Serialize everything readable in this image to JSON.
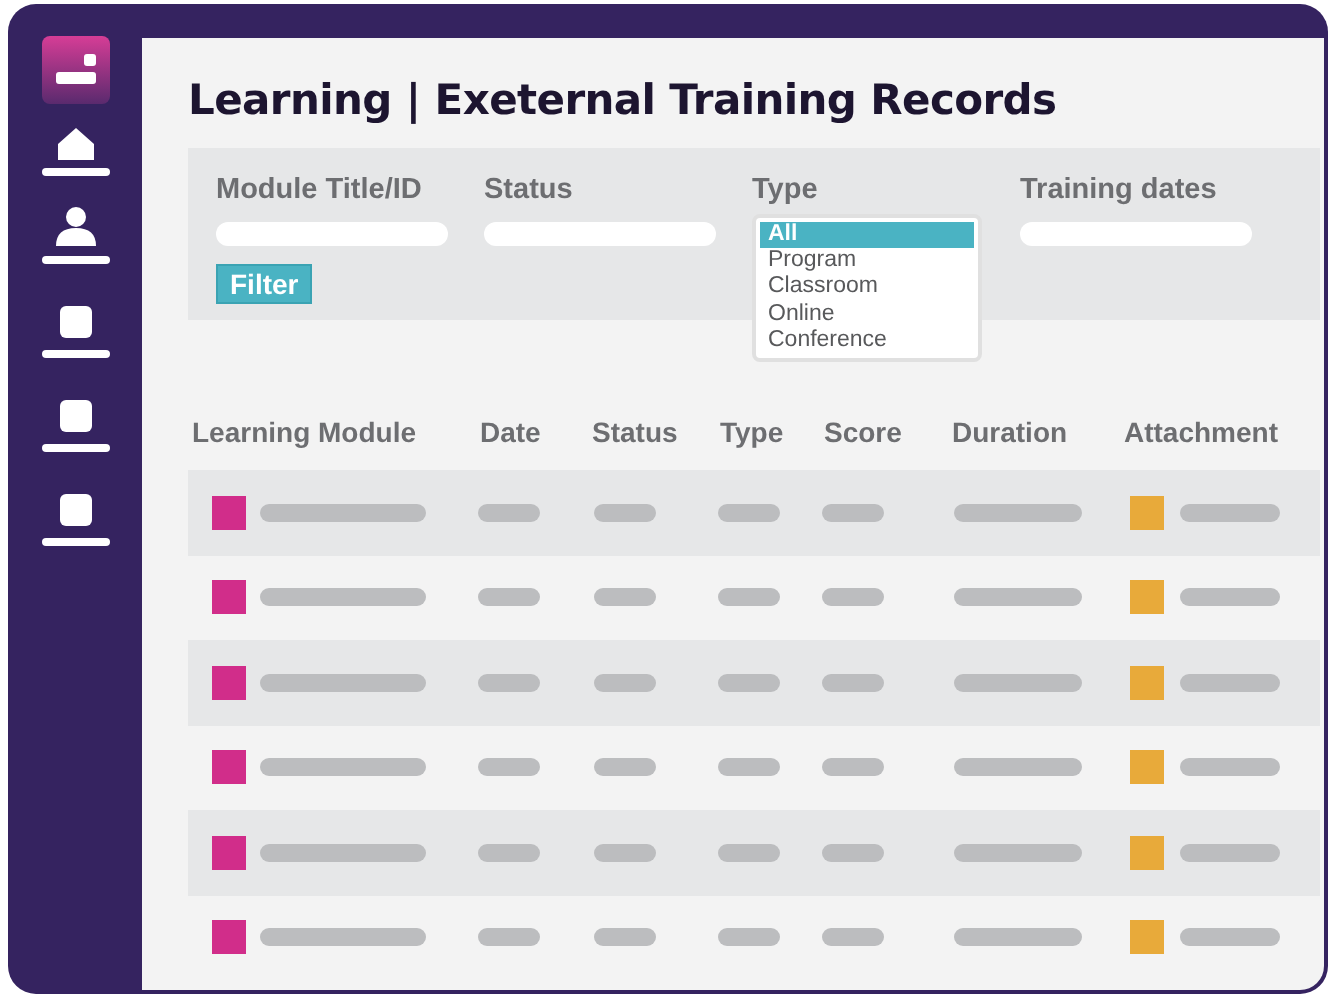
{
  "title": "Learning | Exeternal Training Records",
  "filters": [
    {
      "label": "Module Title/ID",
      "kind": "text"
    },
    {
      "label": "Status",
      "kind": "text"
    },
    {
      "label": "Type",
      "kind": "list",
      "options": [
        {
          "label": "All",
          "selected": true
        },
        {
          "label": "Program",
          "selected": false
        },
        {
          "label": "Classroom",
          "selected": false
        },
        {
          "label": "Online",
          "selected": false
        },
        {
          "label": "Conference",
          "selected": false
        }
      ]
    },
    {
      "label": "Training dates",
      "kind": "text"
    }
  ],
  "filter_button": "Filter",
  "columns": [
    "Learning Module",
    "Date",
    "Status",
    "Type",
    "Score",
    "Duration",
    "Attachment"
  ],
  "rows": [
    {
      "highlighted": true
    },
    {
      "highlighted": false
    },
    {
      "highlighted": true
    },
    {
      "highlighted": false
    },
    {
      "highlighted": true
    },
    {
      "highlighted": false
    }
  ]
}
